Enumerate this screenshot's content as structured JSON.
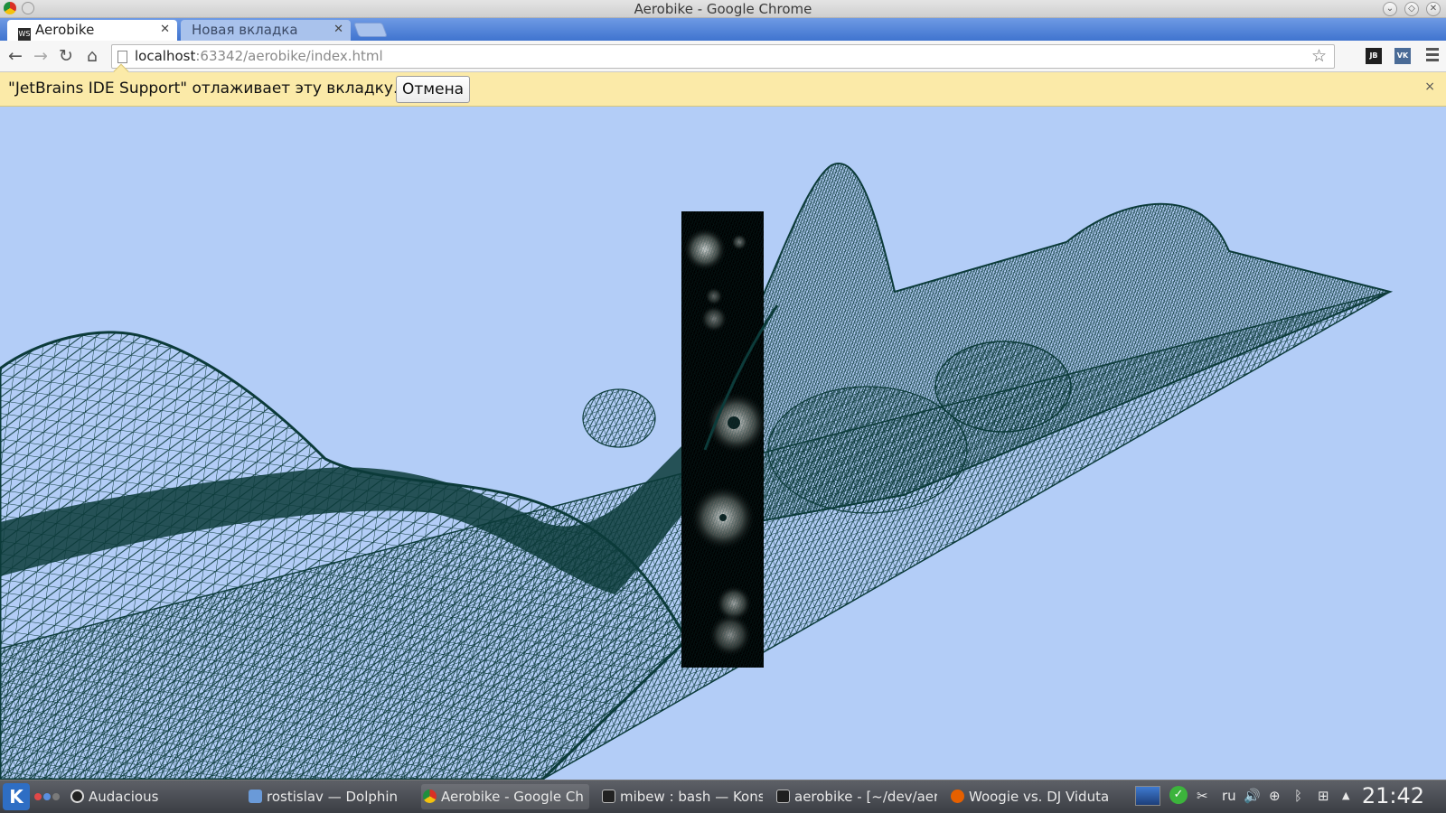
{
  "window": {
    "title": "Aerobike - Google Chrome"
  },
  "tabs": [
    {
      "label": "Aerobike",
      "favicon": "webstorm-icon"
    },
    {
      "label": "Новая вкладка"
    }
  ],
  "toolbar": {
    "url_host": "localhost",
    "url_rest": ":63342/aerobike/index.html",
    "ext1": "JB",
    "ext2": "VK"
  },
  "infobar": {
    "message": "\"JetBrains IDE Support\" отлаживает эту вкладку.",
    "cancel_label": "Отмена",
    "close_glyph": "×"
  },
  "colors": {
    "sky": "#b3cdf7",
    "mesh": "#0c3b3a",
    "panel": "#000000"
  },
  "taskbar": {
    "tasks": [
      {
        "label": "Audacious"
      },
      {
        "label": "rostislav — Dolphin"
      },
      {
        "label": "Aerobike - Google Ch"
      },
      {
        "label": "mibew : bash — Kons"
      },
      {
        "label": "aerobike - [~/dev/aer"
      },
      {
        "label": "Woogie vs. DJ Viduta"
      }
    ],
    "lang": "ru",
    "clock": "21:42"
  }
}
